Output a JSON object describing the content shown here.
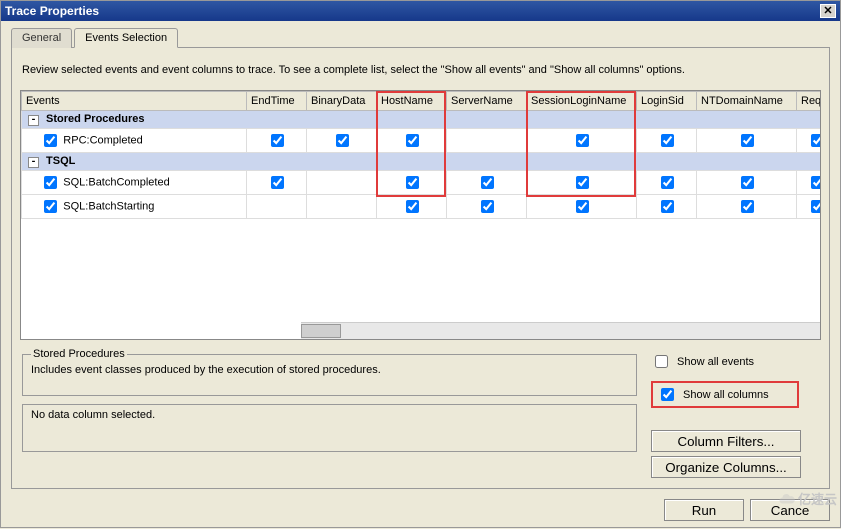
{
  "window": {
    "title": "Trace Properties"
  },
  "tabs": {
    "general": "General",
    "events": "Events Selection"
  },
  "instruction": "Review selected events and event columns to trace. To see a complete list, select the \"Show all events\" and \"Show all columns\" options.",
  "columns": [
    "Events",
    "EndTime",
    "BinaryData",
    "HostName",
    "ServerName",
    "SessionLoginName",
    "LoginSid",
    "NTDomainName",
    "Requ"
  ],
  "groups": [
    {
      "name": "Stored Procedures",
      "rows": [
        {
          "name": "RPC:Completed",
          "checked": true,
          "cells": [
            true,
            true,
            true,
            null,
            true,
            true,
            true,
            true
          ]
        }
      ]
    },
    {
      "name": "TSQL",
      "rows": [
        {
          "name": "SQL:BatchCompleted",
          "checked": true,
          "cells": [
            true,
            null,
            true,
            true,
            true,
            true,
            true,
            true
          ]
        },
        {
          "name": "SQL:BatchStarting",
          "checked": true,
          "cells": [
            null,
            null,
            true,
            true,
            true,
            true,
            true,
            true
          ]
        }
      ]
    }
  ],
  "info": {
    "group_legend": "Stored Procedures",
    "group_desc": "Includes event classes produced by the execution of stored procedures.",
    "col_desc": "No data column selected."
  },
  "options": {
    "show_all_events": {
      "label": "Show all events",
      "checked": false
    },
    "show_all_columns": {
      "label": "Show all columns",
      "checked": true
    }
  },
  "buttons": {
    "column_filters": "Column Filters...",
    "organize_columns": "Organize Columns...",
    "run": "Run",
    "cancel": "Cance",
    "help": ""
  },
  "watermark": "亿速云"
}
